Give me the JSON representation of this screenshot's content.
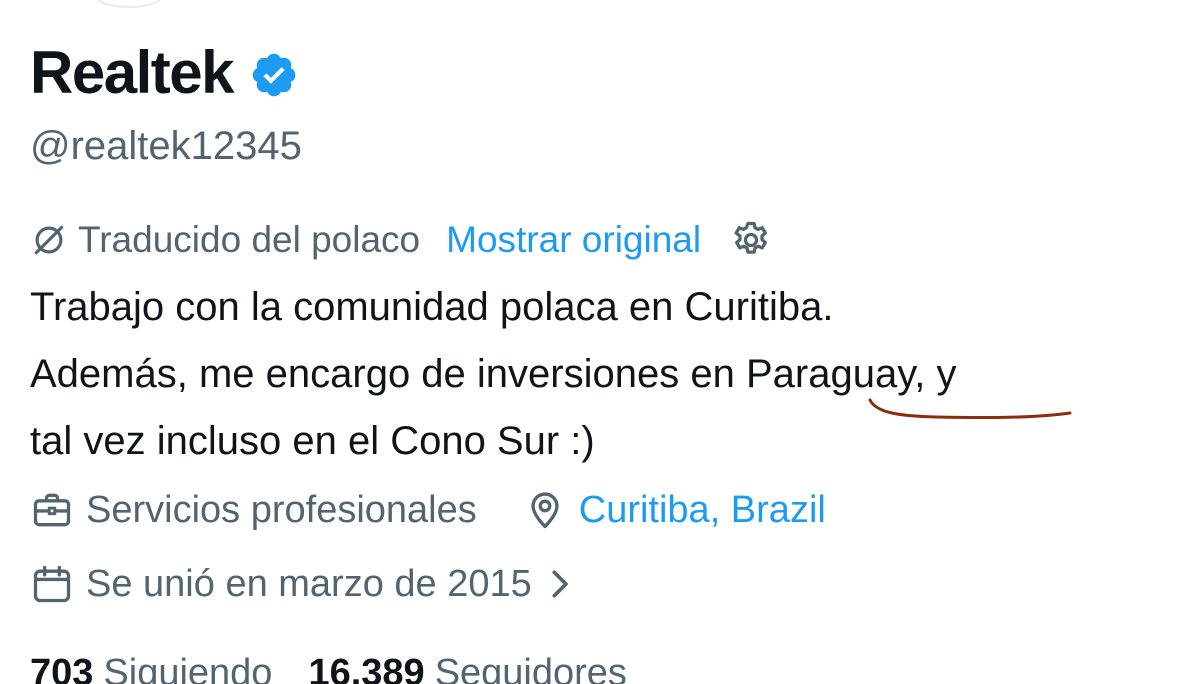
{
  "profile": {
    "display_name": "Realtek",
    "handle": "@realtek12345",
    "verified_icon": "verified-badge-icon"
  },
  "translation": {
    "notice": "Traducido del polaco",
    "show_original": "Mostrar original",
    "settings_icon": "gear-icon"
  },
  "bio": {
    "text": "Trabajo con la comunidad polaca en Curitiba.\nAdemás, me encargo de inversiones en Paraguay, y\ntal vez incluso en el Cono Sur :)"
  },
  "meta": {
    "category": "Servicios profesionales",
    "location": "Curitiba, Brazil",
    "joined": "Se unió en marzo de 2015"
  },
  "stats": {
    "following_count": "703",
    "following_label": "Siguiendo",
    "followers_count": "16.389",
    "followers_label": "Seguidores"
  },
  "colors": {
    "accent": "#1d9bf0",
    "muted": "#536471",
    "text": "#0f1419",
    "annotation": "#8b2e0e"
  }
}
